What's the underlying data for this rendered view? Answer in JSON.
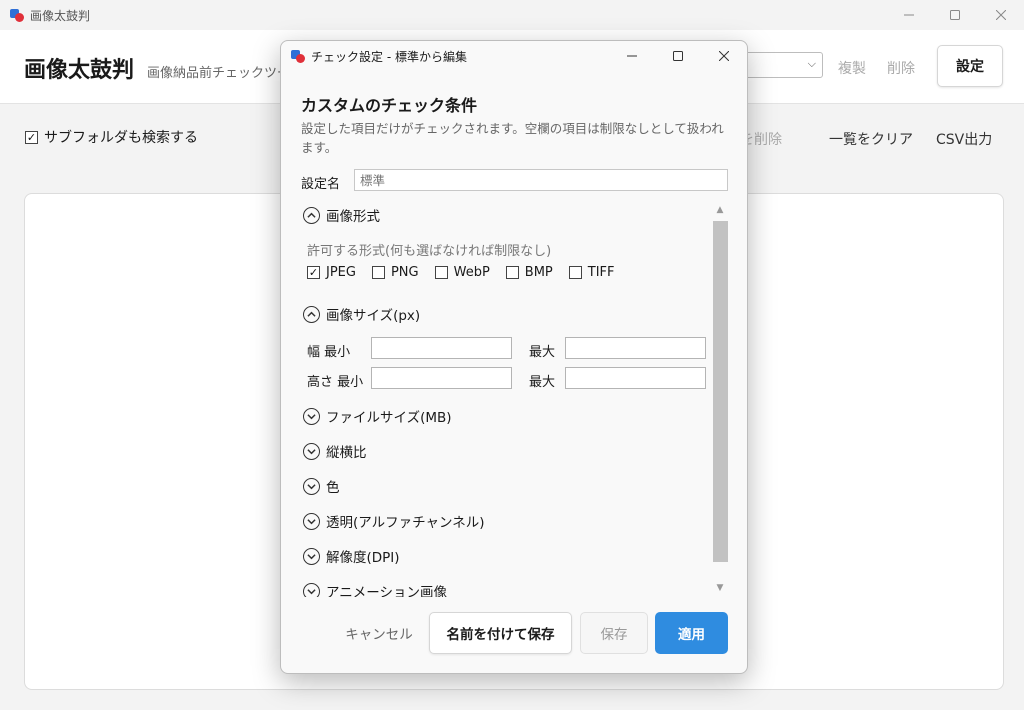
{
  "window": {
    "title": "画像太鼓判"
  },
  "header": {
    "app_name": "画像太鼓判",
    "subtitle": "画像納品前チェックツール",
    "duplicate_label": "複製",
    "delete_label": "削除",
    "settings_label": "設定"
  },
  "toolbar": {
    "subfolder_label": "サブフォルダも検索する",
    "subfolder_checked": true,
    "remove_partial": "を削除",
    "clear_label": "一覧をクリア",
    "csv_label": "CSV出力"
  },
  "dialog": {
    "title": "チェック設定 - 標準から編集",
    "heading": "カスタムのチェック条件",
    "description": "設定した項目だけがチェックされます。空欄の項目は制限なしとして扱われます。",
    "name_label": "設定名",
    "name_placeholder": "標準",
    "sections": {
      "format": {
        "label": "画像形式",
        "sub_label": "許可する形式(何も選ばなければ制限なし)",
        "formats": [
          {
            "label": "JPEG",
            "checked": true
          },
          {
            "label": "PNG",
            "checked": false
          },
          {
            "label": "WebP",
            "checked": false
          },
          {
            "label": "BMP",
            "checked": false
          },
          {
            "label": "TIFF",
            "checked": false
          }
        ]
      },
      "size": {
        "label": "画像サイズ(px)",
        "width_min_label": "幅 最小",
        "height_min_label": "高さ 最小",
        "max_label": "最大"
      },
      "file_size": {
        "label": "ファイルサイズ(MB)"
      },
      "aspect": {
        "label": "縦横比"
      },
      "color": {
        "label": "色"
      },
      "alpha": {
        "label": "透明(アルファチャンネル)"
      },
      "dpi": {
        "label": "解像度(DPI)"
      },
      "animation": {
        "label": "アニメーション画像"
      }
    },
    "buttons": {
      "cancel": "キャンセル",
      "save_as": "名前を付けて保存",
      "save": "保存",
      "apply": "適用"
    }
  },
  "colors": {
    "accent": "#2f8ce0",
    "brand_blue": "#2f6fd6",
    "brand_red": "#e0303a"
  }
}
